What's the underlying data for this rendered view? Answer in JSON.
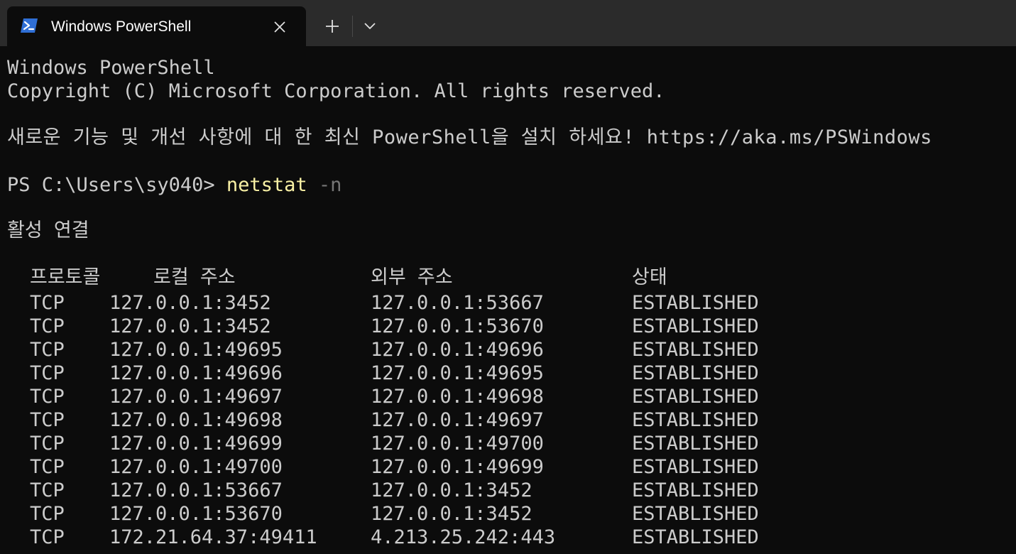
{
  "tab": {
    "title": "Windows PowerShell",
    "icon": "powershell-icon"
  },
  "buttons": {
    "close_icon": "close-icon",
    "new_tab_icon": "plus-icon",
    "dropdown_icon": "chevron-down-icon"
  },
  "terminal": {
    "header_line1": "Windows PowerShell",
    "header_line2": "Copyright (C) Microsoft Corporation. All rights reserved.",
    "notice": "새로운 기능 및 개선 사항에 대 한 최신 PowerShell을 설치 하세요! https://aka.ms/PSWindows",
    "prompt": "PS C:\\Users\\sy040> ",
    "command": "netstat",
    "argument": "-n",
    "section_title": "활성 연결",
    "columns": [
      "프로토콜",
      "로컬 주소",
      "외부 주소",
      "상태"
    ],
    "rows": [
      [
        "TCP",
        "127.0.0.1:3452",
        "127.0.0.1:53667",
        "ESTABLISHED"
      ],
      [
        "TCP",
        "127.0.0.1:3452",
        "127.0.0.1:53670",
        "ESTABLISHED"
      ],
      [
        "TCP",
        "127.0.0.1:49695",
        "127.0.0.1:49696",
        "ESTABLISHED"
      ],
      [
        "TCP",
        "127.0.0.1:49696",
        "127.0.0.1:49695",
        "ESTABLISHED"
      ],
      [
        "TCP",
        "127.0.0.1:49697",
        "127.0.0.1:49698",
        "ESTABLISHED"
      ],
      [
        "TCP",
        "127.0.0.1:49698",
        "127.0.0.1:49697",
        "ESTABLISHED"
      ],
      [
        "TCP",
        "127.0.0.1:49699",
        "127.0.0.1:49700",
        "ESTABLISHED"
      ],
      [
        "TCP",
        "127.0.0.1:49700",
        "127.0.0.1:49699",
        "ESTABLISHED"
      ],
      [
        "TCP",
        "127.0.0.1:53667",
        "127.0.0.1:3452",
        "ESTABLISHED"
      ],
      [
        "TCP",
        "127.0.0.1:53670",
        "127.0.0.1:3452",
        "ESTABLISHED"
      ],
      [
        "TCP",
        "172.21.64.37:49411",
        "4.213.25.242:443",
        "ESTABLISHED"
      ]
    ]
  },
  "colors": {
    "background": "#0c0c0c",
    "titlebar": "#2b2b2b",
    "text": "#cccccc",
    "command": "#f9f1a5",
    "argument": "#767676",
    "icon_blue": "#2f6fd6"
  }
}
